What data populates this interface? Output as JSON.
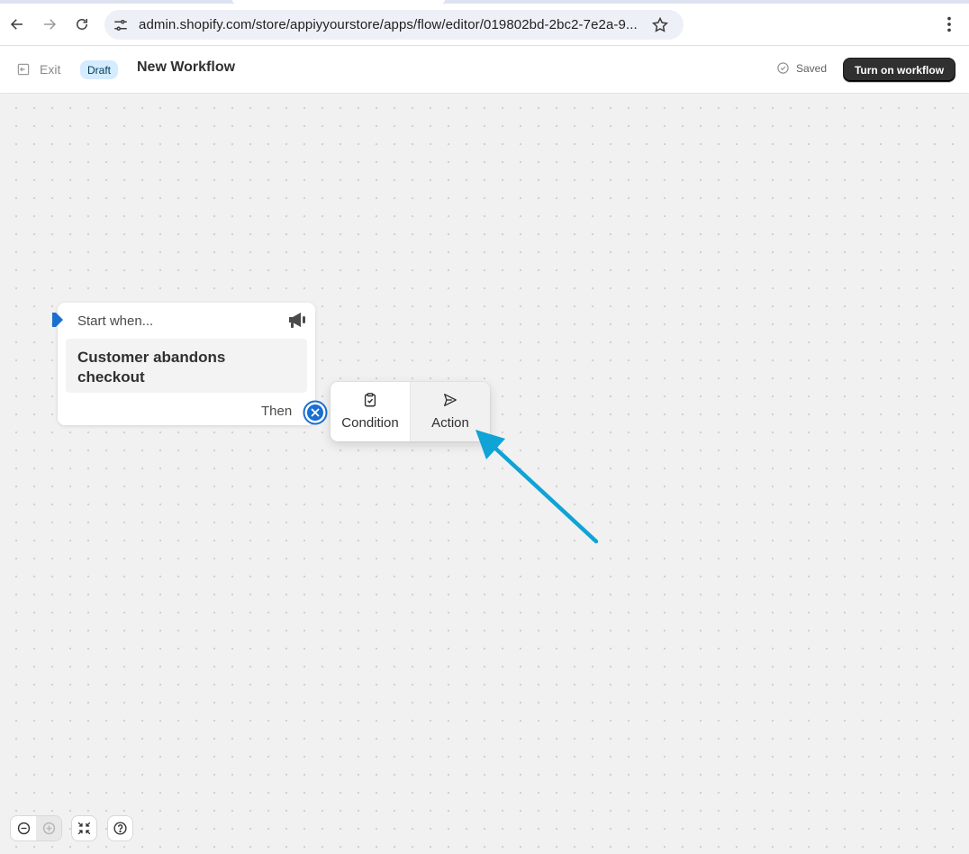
{
  "browser": {
    "url": "admin.shopify.com/store/appiyyourstore/apps/flow/editor/019802bd-2bc2-7e2a-9...",
    "back_icon": "arrow-left-icon",
    "forward_icon": "arrow-right-icon",
    "reload_icon": "reload-icon",
    "site_info_icon": "tune-icon",
    "bookmark_icon": "star-icon",
    "menu_icon": "kebab-menu-icon"
  },
  "header": {
    "exit_label": "Exit",
    "draft_label": "Draft",
    "title": "New Workflow",
    "saved_label": "Saved",
    "primary_button": "Turn on workflow"
  },
  "trigger": {
    "start_label": "Start when...",
    "event": "Customer abandons checkout",
    "then_label": "Then"
  },
  "popover": {
    "items": [
      {
        "label": "Condition",
        "icon": "clipboard-check-icon"
      },
      {
        "label": "Action",
        "icon": "send-icon"
      }
    ]
  },
  "controls": {
    "zoom_out_icon": "zoom-out-icon",
    "zoom_in_icon": "zoom-in-icon",
    "fit_icon": "fit-view-icon",
    "help_icon": "help-icon"
  },
  "colors": {
    "accent_blue": "#1a6fd0",
    "annotation_arrow": "#0fa3d6",
    "primary_button": "#303030",
    "draft_badge": "#d5ebff"
  }
}
